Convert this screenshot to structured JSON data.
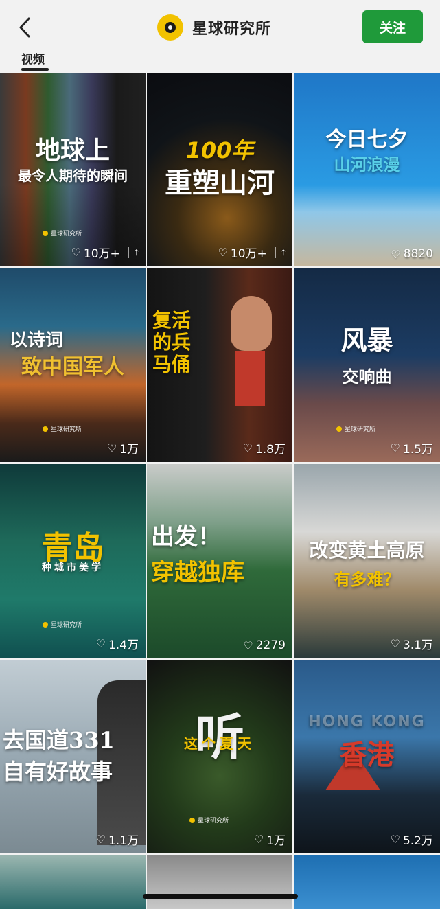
{
  "header": {
    "back_icon": "chevron-left-icon",
    "logo_icon": "planet-logo-icon",
    "title": "星球研究所",
    "follow_label": "关注",
    "tab_label": "视频"
  },
  "colors": {
    "follow_bg": "#1f9a3a",
    "logo_yellow": "#f2c200"
  },
  "videos": [
    {
      "title": "地球上",
      "subtitle": "最令人期待的瞬间",
      "likes": "10万+",
      "pinned": true
    },
    {
      "title": "100年",
      "subtitle": "重塑山河",
      "likes": "10万+",
      "pinned": true
    },
    {
      "title": "今日七夕",
      "subtitle": "山河浪漫",
      "likes": "8820",
      "pinned": false
    },
    {
      "title": "以诗词",
      "subtitle": "致中国军人",
      "likes": "1万",
      "pinned": false
    },
    {
      "title": "复活的兵马俑",
      "subtitle": "",
      "likes": "1.8万",
      "pinned": false
    },
    {
      "title": "风暴",
      "subtitle": "交响曲",
      "likes": "1.5万",
      "pinned": false
    },
    {
      "title": "青岛",
      "subtitle": "种城市美学",
      "likes": "1.4万",
      "pinned": false
    },
    {
      "title": "出发！",
      "subtitle": "穿越独库",
      "likes": "2279",
      "pinned": false
    },
    {
      "title": "改变黄土高原",
      "subtitle": "有多难？",
      "likes": "3.1万",
      "pinned": false
    },
    {
      "title": "去国道331",
      "subtitle": "自有好故事",
      "likes": "1.1万",
      "pinned": false
    },
    {
      "title": "听",
      "subtitle": "这个夏天",
      "likes": "1万",
      "pinned": false
    },
    {
      "title": "香港",
      "subtitle": "HONG KONG",
      "likes": "5.2万",
      "pinned": false
    }
  ],
  "brand_text": "星球研究所"
}
